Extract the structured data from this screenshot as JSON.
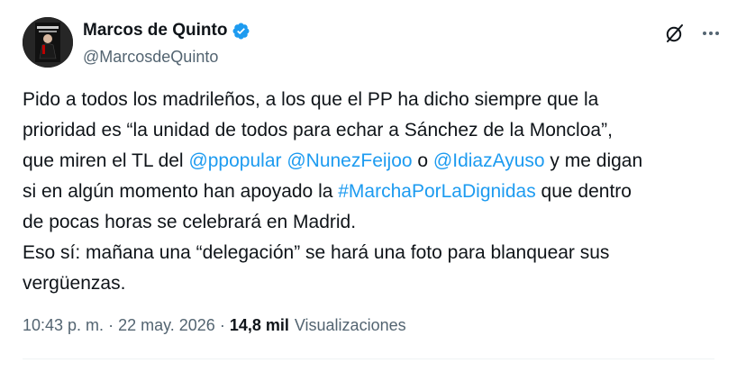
{
  "author": {
    "display_name": "Marcos de Quinto",
    "handle": "@MarcosdeQuinto",
    "verified": true,
    "avatar_icon": "book-cover-avatar"
  },
  "header_actions": {
    "grok_icon": "grok-icon",
    "more_icon": "more-horizontal-icon"
  },
  "tweet": {
    "lines": [
      [
        {
          "t": "Pido a todos los madrileños, a los que el PP ha dicho siempre que la",
          "link": false
        }
      ],
      [
        {
          "t": "prioridad es “la unidad de todos para echar a Sánchez de la Moncloa”,",
          "link": false
        }
      ],
      [
        {
          "t": "que miren el TL del ",
          "link": false
        },
        {
          "t": "@ppopular",
          "link": true
        },
        {
          "t": " ",
          "link": false
        },
        {
          "t": "@NunezFeijoo",
          "link": true
        },
        {
          "t": " o ",
          "link": false
        },
        {
          "t": "@IdiazAyuso",
          "link": true
        },
        {
          "t": " y me digan",
          "link": false
        }
      ],
      [
        {
          "t": "si en algún momento han apoyado la ",
          "link": false
        },
        {
          "t": "#MarchaPorLaDignidas",
          "link": true
        },
        {
          "t": " que dentro",
          "link": false
        }
      ],
      [
        {
          "t": "de pocas horas se celebrará en Madrid.",
          "link": false
        }
      ],
      [
        {
          "t": "Eso sí: mañana una “delegación” se hará una foto para blanquear sus",
          "link": false
        }
      ],
      [
        {
          "t": "vergüenzas.",
          "link": false
        }
      ]
    ]
  },
  "meta": {
    "time": "10:43 p. m.",
    "separator": "·",
    "date": "22 may. 2026",
    "views_count": "14,8 mil",
    "views_label": "Visualizaciones"
  },
  "colors": {
    "link": "#1d9bf0",
    "secondary_text": "#536471",
    "verified_badge": "#1d9bf0"
  }
}
